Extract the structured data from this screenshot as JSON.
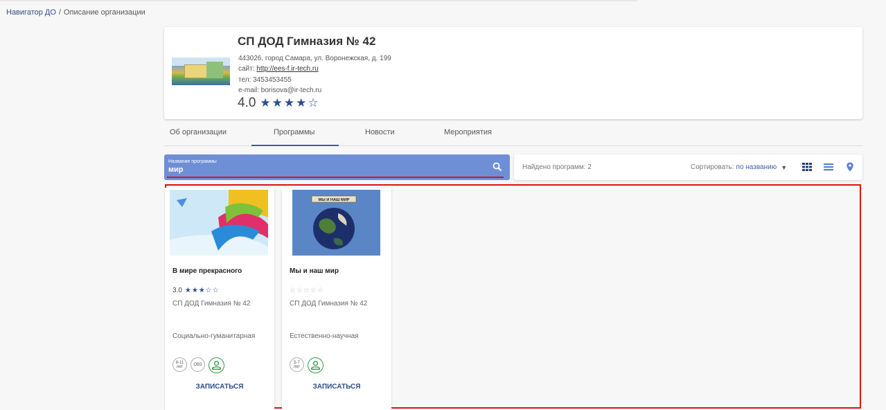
{
  "breadcrumb": {
    "root": "Навигатор ДО",
    "separator": "/",
    "current": "Описание организации"
  },
  "org": {
    "name": "СП ДОД Гимназия № 42",
    "address": "443026, город Самара, ул. Воронежская, д. 199",
    "site_label": "сайт:",
    "site_url": "http://ees-f.ir-tech.ru",
    "phone": "тел: 3453453455",
    "email": "e-mail: borisova@ir-tech.ru",
    "rating": "4.0",
    "stars": "★★★★☆"
  },
  "tabs": [
    {
      "label": "Об организации",
      "active": false
    },
    {
      "label": "Программы",
      "active": true
    },
    {
      "label": "Новости",
      "active": false
    },
    {
      "label": "Мероприятия",
      "active": false
    }
  ],
  "search": {
    "label": "Название программы",
    "value": "мир",
    "icon": "search-icon"
  },
  "results": {
    "found": "Найдено программ: 2",
    "sort_label": "Сортировать:",
    "sort_value": "по названию",
    "views": [
      "grid-icon",
      "list-icon",
      "map-pin-icon"
    ]
  },
  "colors": {
    "accent": "#3a5da8",
    "search_bg": "#6e8fd6",
    "highlight": "#e01010",
    "green": "#2e9a44"
  },
  "programs": [
    {
      "title": "В мире прекрасного",
      "rating": "3.0",
      "stars": "★★★☆☆",
      "org": "СП ДОД Гимназия № 42",
      "direction": "Социально-гуманитарная",
      "age_top": "8-11",
      "age_bottom": "лет",
      "extra_badge": "ОВЗ",
      "enroll": "ЗАПИСАТЬСЯ"
    },
    {
      "title": "Мы и наш мир",
      "rating": "",
      "stars": "☆☆☆☆☆",
      "org": "СП ДОД Гимназия № 42",
      "direction": "Естественно-научная",
      "age_top": "5-7",
      "age_bottom": "лет",
      "image_caption": "МЫ И НАШ МИР",
      "enroll": "ЗАПИСАТЬСЯ"
    }
  ]
}
